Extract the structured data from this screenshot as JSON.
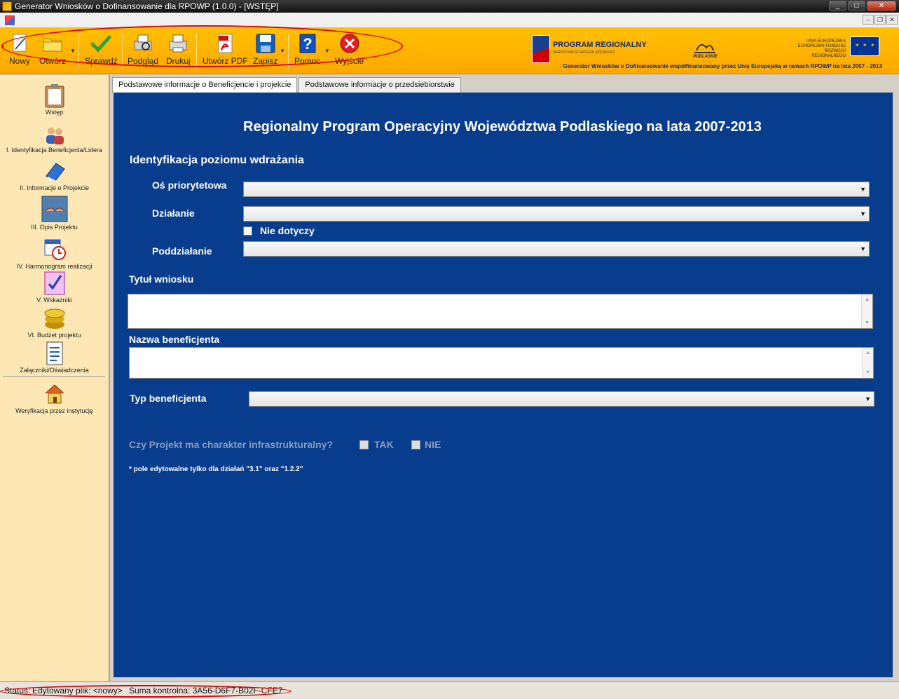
{
  "window": {
    "title": "Generator Wniosków o Dofinansowanie dla RPOWP (1.0.0) - [WSTĘP]",
    "buttons": {
      "minimize": "_",
      "maximize": "□",
      "close": "✕"
    }
  },
  "mdi": {
    "minimize": "–",
    "restore": "❐",
    "close": "✕"
  },
  "toolbar": {
    "new": "Nowy",
    "open": "Otwórz",
    "check": "Sprawdź",
    "preview": "Podgląd",
    "print": "Drukuj",
    "pdf": "Utwórz PDF",
    "save": "Zapisz",
    "help": "Pomoc",
    "exit": "Wyjście",
    "dropdown_glyph": "▼"
  },
  "branding": {
    "program": "PROGRAM REGIONALNY",
    "program_sub": "NARODOWA STRATEGIA SPÓJNOŚCI",
    "region": "PODLASKIE",
    "ue_text": "UNIA EUROPEJSKA\nEUROPEJSKI FUNDUSZ\nROZWOJU REGIONALNEGO",
    "caption": "Generator Wniosków o Dofinansowanie współfinansowany przez Unię Europejską w ramach RPOWP na lata 2007 - 2013"
  },
  "sidebar": {
    "items": [
      {
        "label": "Wstęp",
        "icon": "clipboard-icon"
      },
      {
        "label": "I. Identyfikacja Beneficjenta/Lidera",
        "icon": "users-icon"
      },
      {
        "label": "II. Informacje o Projekcie",
        "icon": "book-icon"
      },
      {
        "label": "III. Opis Projektu",
        "icon": "handshake-icon"
      },
      {
        "label": "IV. Harmonogram realizacji",
        "icon": "calendar-icon"
      },
      {
        "label": "V. Wskaźniki",
        "icon": "checklist-icon"
      },
      {
        "label": "VI. Budżet projektu",
        "icon": "coins-icon"
      },
      {
        "label": "Załączniki/Oświadczenia",
        "icon": "document-icon"
      },
      {
        "label": "Weryfikacja przez instytucję",
        "icon": "house-icon"
      }
    ]
  },
  "tabs": [
    {
      "label": "Podstawowe informacje o Beneficjencie i projekcie",
      "active": true
    },
    {
      "label": "Podstawowe informacje o przedsiebiorstwie",
      "active": false
    }
  ],
  "form": {
    "title": "Regionalny Program Operacyjny Województwa Podlaskiego na lata 2007-2013",
    "section": "Identyfikacja poziomu wdrażania",
    "os_label": "Oś priorytetowa",
    "os_value": "",
    "dzialanie_label": "Działanie",
    "dzialanie_value": "",
    "nie_dotyczy": "Nie dotyczy",
    "poddzialanie_label": "Poddziałanie",
    "poddzialanie_value": "",
    "tytul_label": "Tytuł wniosku",
    "tytul_value": "",
    "nazwa_label": "Nazwa beneficjenta",
    "nazwa_value": "",
    "typ_label": "Typ beneficjenta",
    "typ_value": "",
    "infra_question": "Czy Projekt ma charakter infrastrukturalny?",
    "tak": "TAK",
    "nie": "NIE",
    "note": "* pole edytowalne tylko dla działań \"3.1\" oraz \"1.2.2\"",
    "combo_arrow": "▼",
    "scroll_up": "▲",
    "scroll_down": "▼"
  },
  "status": {
    "status_label": "Status:",
    "file": "Edytowany plik: <nowy>",
    "checksum": "Suma kontrolna: 3A56-D6F7-B02F-CFE7"
  }
}
